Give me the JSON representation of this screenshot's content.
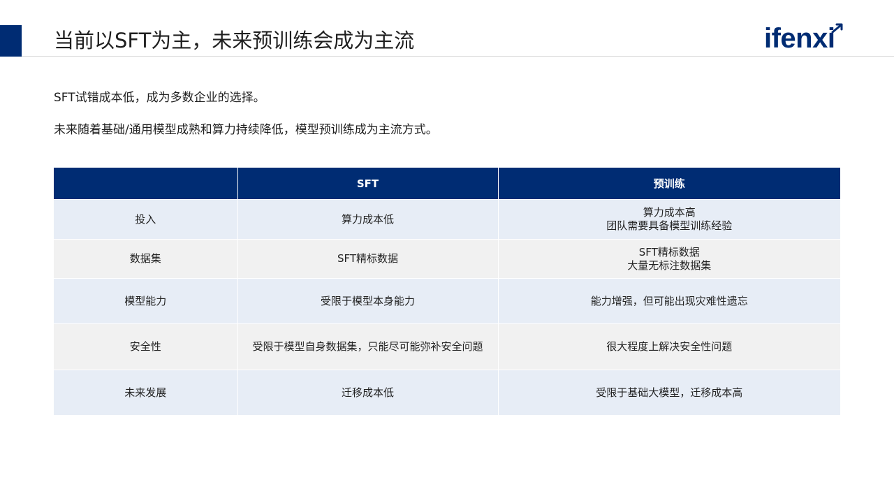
{
  "header": {
    "title": "当前以SFT为主，未来预训练会成为主流",
    "logo_text": "ifenxi"
  },
  "intro": {
    "line1": "SFT试错成本低，成为多数企业的选择。",
    "line2": "未来随着基础/通用模型成熟和算力持续降低，模型预训练成为主流方式。"
  },
  "table": {
    "headers": [
      "",
      "SFT",
      "预训练"
    ],
    "rows": [
      {
        "label": "投入",
        "sft": [
          "算力成本低"
        ],
        "pretrain": [
          "算力成本高",
          "团队需要具备模型训练经验"
        ]
      },
      {
        "label": "数据集",
        "sft": [
          "SFT精标数据"
        ],
        "pretrain": [
          "SFT精标数据",
          "大量无标注数据集"
        ]
      },
      {
        "label": "模型能力",
        "sft": [
          "受限于模型本身能力"
        ],
        "pretrain": [
          "能力增强，但可能出现灾难性遗忘"
        ]
      },
      {
        "label": "安全性",
        "sft": [
          "受限于模型自身数据集，只能尽可能弥补安全问题"
        ],
        "pretrain": [
          "很大程度上解决安全性问题"
        ]
      },
      {
        "label": "未来发展",
        "sft": [
          "迁移成本低"
        ],
        "pretrain": [
          "受限于基础大模型，迁移成本高"
        ]
      }
    ]
  },
  "colors": {
    "brand_navy": "#002c73",
    "row_blue": "#e7edf6",
    "row_gray": "#f1f1f1"
  }
}
